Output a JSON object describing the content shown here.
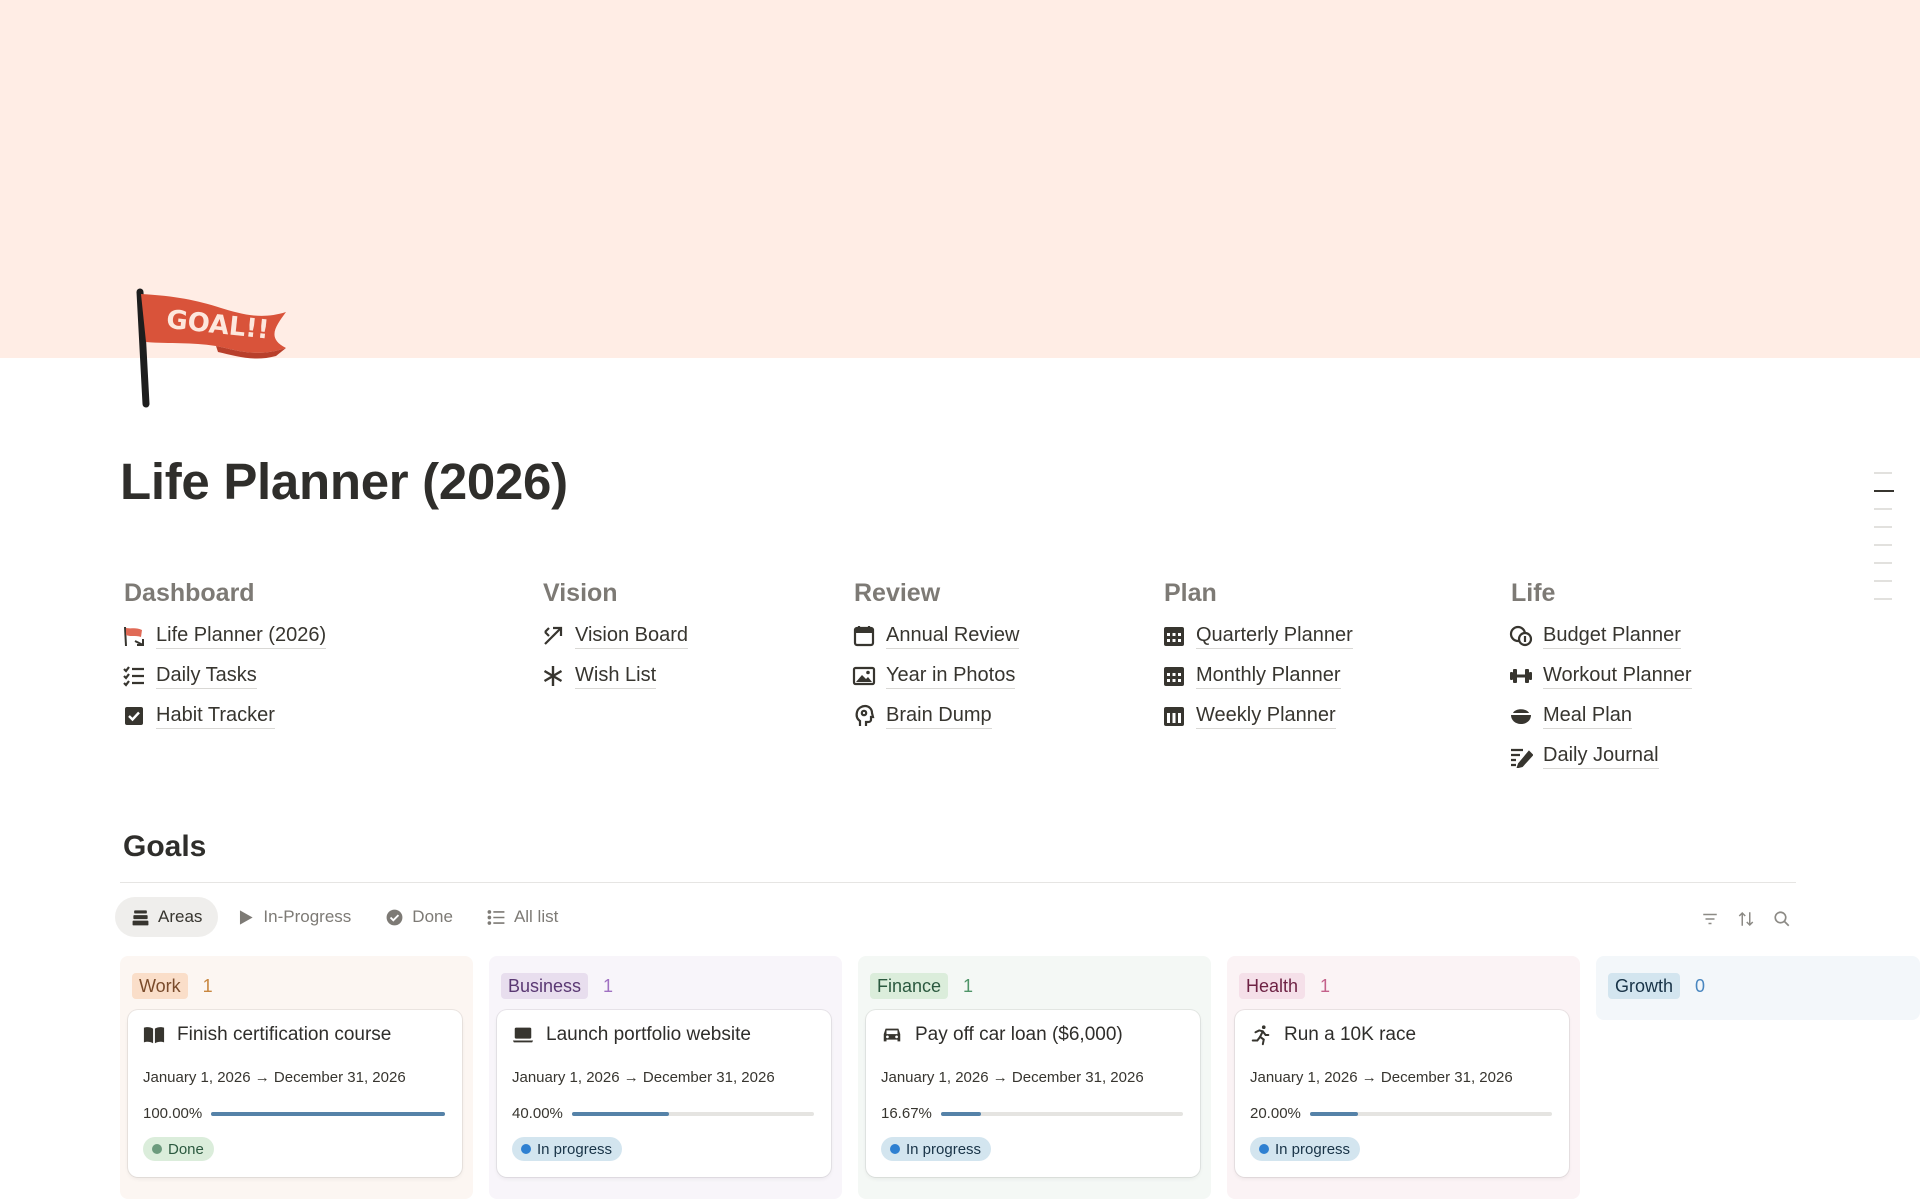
{
  "page": {
    "title": "Life Planner (2026)",
    "icon": "goal-flag-icon",
    "cover_color": "#ffede5"
  },
  "nav": {
    "columns": [
      {
        "heading": "Dashboard",
        "links": [
          {
            "label": "Life Planner (2026)",
            "icon": "flag-icon"
          },
          {
            "label": "Daily Tasks",
            "icon": "checklist-icon"
          },
          {
            "label": "Habit Tracker",
            "icon": "checkbox-icon"
          }
        ]
      },
      {
        "heading": "Vision",
        "links": [
          {
            "label": "Vision Board",
            "icon": "arrow-target-icon"
          },
          {
            "label": "Wish List",
            "icon": "asterisk-icon"
          }
        ]
      },
      {
        "heading": "Review",
        "links": [
          {
            "label": "Annual Review",
            "icon": "calendar-icon"
          },
          {
            "label": "Year in Photos",
            "icon": "photo-icon"
          },
          {
            "label": "Brain Dump",
            "icon": "head-icon"
          }
        ]
      },
      {
        "heading": "Plan",
        "links": [
          {
            "label": "Quarterly Planner",
            "icon": "calendar-grid-icon"
          },
          {
            "label": "Monthly Planner",
            "icon": "calendar-grid-icon"
          },
          {
            "label": "Weekly Planner",
            "icon": "calendar-grid-icon"
          }
        ]
      },
      {
        "heading": "Life",
        "links": [
          {
            "label": "Budget Planner",
            "icon": "coins-icon"
          },
          {
            "label": "Workout Planner",
            "icon": "dumbbell-icon"
          },
          {
            "label": "Meal Plan",
            "icon": "bowl-icon"
          },
          {
            "label": "Daily Journal",
            "icon": "write-icon"
          }
        ]
      }
    ]
  },
  "goals": {
    "title": "Goals",
    "views": [
      {
        "label": "Areas",
        "icon": "stack-icon",
        "active": true
      },
      {
        "label": "In-Progress",
        "icon": "play-icon",
        "active": false
      },
      {
        "label": "Done",
        "icon": "check-circle-icon",
        "active": false
      },
      {
        "label": "All list",
        "icon": "list-icon",
        "active": false
      }
    ],
    "toolbar": [
      "filter-icon",
      "sort-icon",
      "search-icon"
    ],
    "board": [
      {
        "area": "Work",
        "count": "1",
        "tag_bg": "#fadec9",
        "tag_fg": "#7a4b2b",
        "count_fg": "#c8863f",
        "col_bg": "#fcf6f2",
        "card": {
          "title": "Finish certification course",
          "icon": "book-icon",
          "dates": "January 1, 2026 → December 31, 2026",
          "progress_label": "100.00%",
          "progress": 1.0,
          "status": "Done",
          "status_bg": "#dbeddb",
          "status_fg": "#2b593f",
          "dot": "#6c9b7d"
        }
      },
      {
        "area": "Business",
        "count": "1",
        "tag_bg": "#e8deee",
        "tag_fg": "#5a3873",
        "count_fg": "#a071c2",
        "col_bg": "#f8f5fa",
        "card": {
          "title": "Launch portfolio website",
          "icon": "laptop-icon",
          "dates": "January 1, 2026 → December 31, 2026",
          "progress_label": "40.00%",
          "progress": 0.4,
          "status": "In progress",
          "status_bg": "#d3e5ef",
          "status_fg": "#183347",
          "dot": "#2f80d1"
        }
      },
      {
        "area": "Finance",
        "count": "1",
        "tag_bg": "#dbeddb",
        "tag_fg": "#2b593f",
        "count_fg": "#4f9568",
        "col_bg": "#f4f8f5",
        "card": {
          "title": "Pay off car loan ($6,000)",
          "icon": "car-icon",
          "dates": "January 1, 2026 → December 31, 2026",
          "progress_label": "16.67%",
          "progress": 0.1667,
          "status": "In progress",
          "status_bg": "#d3e5ef",
          "status_fg": "#183347",
          "dot": "#2f80d1"
        }
      },
      {
        "area": "Health",
        "count": "1",
        "tag_bg": "#f5e0e9",
        "tag_fg": "#6e2244",
        "count_fg": "#c4618b",
        "col_bg": "#fbf3f5",
        "card": {
          "title": "Run a 10K race",
          "icon": "runner-icon",
          "dates": "January 1, 2026 → December 31, 2026",
          "progress_label": "20.00%",
          "progress": 0.2,
          "status": "In progress",
          "status_bg": "#d3e5ef",
          "status_fg": "#183347",
          "dot": "#2f80d1"
        }
      },
      {
        "area": "Growth",
        "count": "0",
        "tag_bg": "#d3e5ef",
        "tag_fg": "#183347",
        "count_fg": "#4a87c0",
        "col_bg": "#f3f7fa",
        "card": null
      }
    ]
  }
}
